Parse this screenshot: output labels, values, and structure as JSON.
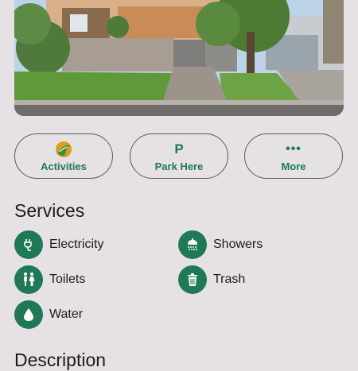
{
  "photo": {
    "alt_name": "campsite-photo"
  },
  "actions": [
    {
      "label": "Activities",
      "icon": "activities-icon"
    },
    {
      "label": "Park Here",
      "icon": "parking-icon",
      "glyph": "P"
    },
    {
      "label": "More",
      "icon": "more-dots-icon",
      "glyph": "•••"
    }
  ],
  "services": {
    "title": "Services",
    "items": [
      {
        "label": "Electricity",
        "icon": "electricity-plug-icon"
      },
      {
        "label": "Showers",
        "icon": "shower-icon"
      },
      {
        "label": "Toilets",
        "icon": "toilets-icon"
      },
      {
        "label": "Trash",
        "icon": "trash-icon"
      },
      {
        "label": "Water",
        "icon": "water-drop-icon"
      }
    ]
  },
  "description": {
    "title": "Description"
  },
  "colors": {
    "accent": "#1e7a55",
    "background": "#e6e1e5",
    "text": "#1c1b1f",
    "outline": "#5b5b5b"
  }
}
